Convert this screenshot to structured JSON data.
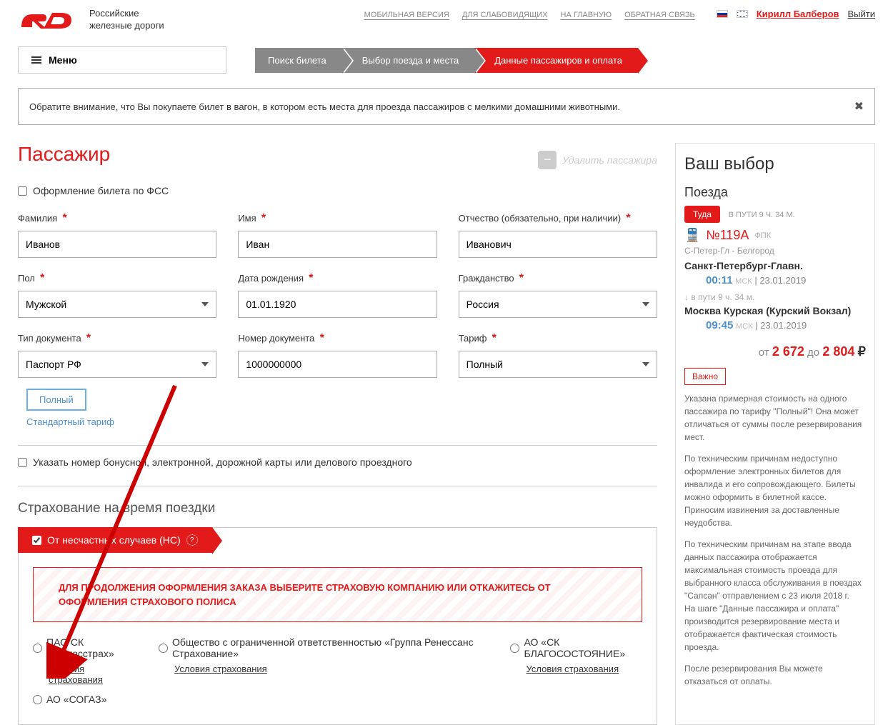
{
  "header": {
    "brand_line1": "Российские",
    "brand_line2": "железные дороги",
    "top_links": [
      "МОБИЛЬНАЯ ВЕРСИЯ",
      "ДЛЯ СЛАБОВИДЯЩИХ",
      "НА ГЛАВНУЮ",
      "ОБРАТНАЯ СВЯЗЬ"
    ],
    "user_name": "Кирилл Балберов",
    "logout": "Выйти",
    "menu": "Меню"
  },
  "breadcrumb": [
    "Поиск билета",
    "Выбор поезда и места",
    "Данные пассажиров и оплата"
  ],
  "notice": "Обратите внимание, что Вы покупаете билет в вагон, в котором есть места для проезда пассажиров с мелкими домашними животными.",
  "passenger": {
    "title": "Пассажир",
    "delete": "Удалить пассажира",
    "fss_label": "Оформление билета по ФСС",
    "fields": {
      "surname_label": "Фамилия",
      "surname_val": "Иванов",
      "name_label": "Имя",
      "name_val": "Иван",
      "patronymic_label": "Отчество (обязательно, при наличии)",
      "patronymic_val": "Иванович",
      "gender_label": "Пол",
      "gender_val": "Мужской",
      "dob_label": "Дата рождения",
      "dob_val": "01.01.1920",
      "citizenship_label": "Гражданство",
      "citizenship_val": "Россия",
      "doctype_label": "Тип документа",
      "doctype_val": "Паспорт РФ",
      "docnum_label": "Номер документа",
      "docnum_val": "1000000000",
      "tariff_label": "Тариф",
      "tariff_val": "Полный"
    },
    "tariff_full": "Полный",
    "tariff_standard": "Стандартный тариф",
    "bonus_label": "Указать номер бонусной, электронной, дорожной карты или делового проездного"
  },
  "insurance": {
    "title": "Страхование на время поездки",
    "ribbon": "От несчастных случаев (НС)",
    "warning": "ДЛЯ ПРОДОЛЖЕНИЯ ОФОРМЛЕНИЯ ЗАКАЗА ВЫБЕРИТЕ СТРАХОВУЮ КОМПАНИЮ ИЛИ ОТКАЖИТЕСЬ ОТ ОФОРМЛЕНИЯ СТРАХОВОГО ПОЛИСА",
    "terms": "Условия страхования",
    "options": [
      "ПАО СК «Росгосстрах»",
      "Общество с ограниченной ответственностью «Группа Ренессанс Страхование»",
      "АО «СК БЛАГОСОСТОЯНИЕ»",
      "АО «СОГАЗ»"
    ]
  },
  "sidebar": {
    "title": "Ваш выбор",
    "trains": "Поезда",
    "tuda": "Туда",
    "travel_time": "В ПУТИ 9 Ч. 34 М.",
    "train_num": "№119А",
    "train_co": "ФПК",
    "route": "С-Петер-Гл - Белгород",
    "from_station": "Санкт-Петербург-Главн.",
    "from_time": "00:11",
    "from_tz": "МСК",
    "from_date": "23.01.2019",
    "duration": "в пути  9 ч. 34 м.",
    "to_station": "Москва Курская (Курский Вокзал)",
    "to_time": "09:45",
    "to_tz": "МСК",
    "to_date": "23.01.2019",
    "price_from_label": "от",
    "price_from": "2 672",
    "price_to_label": "до",
    "price_to": "2 804",
    "important": "Важно",
    "info1": "Указана примерная стоимость на одного пассажира по тарифу \"Полный\"! Она может отличаться от суммы после резервирования мест.",
    "info2": "По техническим причинам недоступно оформление электронных билетов для инвалида и его сопровождающего. Билеты можно оформить в билетной кассе. Приносим извинения за доставленные неудобства.",
    "info3": "По техническим причинам на этапе ввода данных пассажира отображается максимальная стоимость проезда для выбранного класса обслуживания в поездах \"Сапсан\" отправлением с 23 июля 2018 г.\nНа шаге \"Данные пассажира и оплата\" производится резервирование места и отображается фактическая стоимость проезда.",
    "info4": "После резервирования Вы можете отказаться от оплаты."
  }
}
